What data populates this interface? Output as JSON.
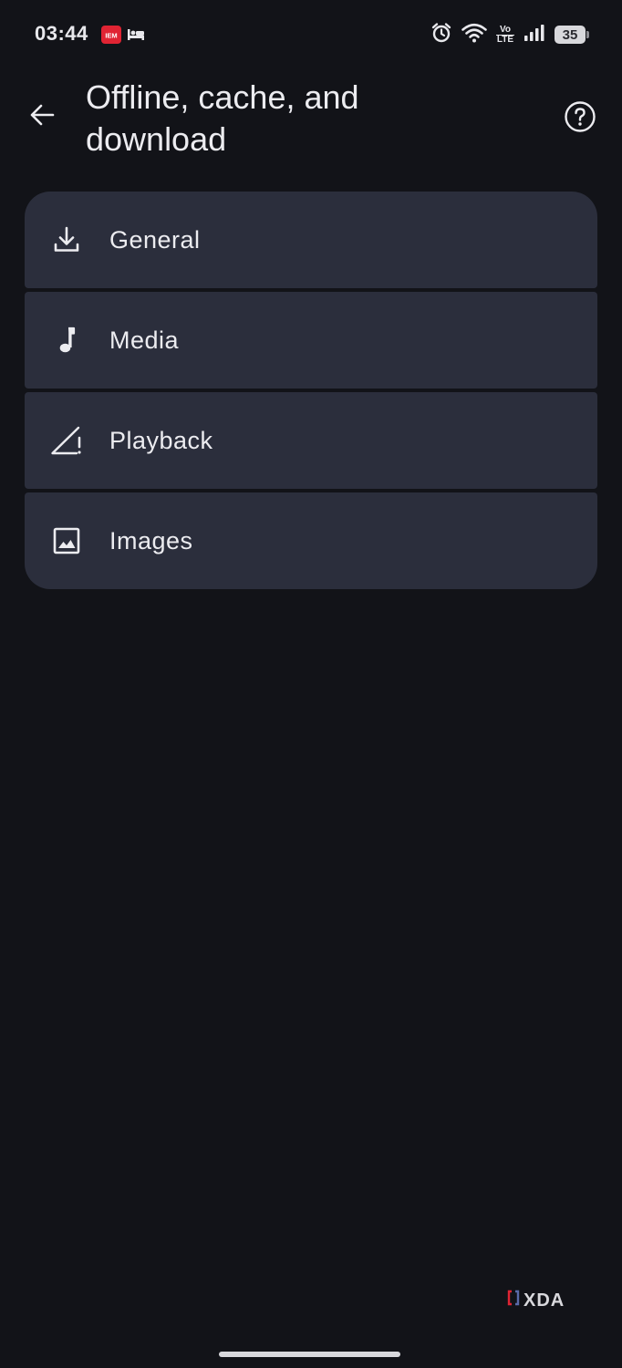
{
  "status_bar": {
    "time": "03:44",
    "notif_badge": "IEM",
    "volte_top": "Vo",
    "volte_bottom": "LTE",
    "battery": "35"
  },
  "header": {
    "title": "Offline, cache, and download"
  },
  "settings": {
    "items": [
      {
        "label": "General",
        "icon": "download-icon"
      },
      {
        "label": "Media",
        "icon": "music-note-icon"
      },
      {
        "label": "Playback",
        "icon": "signal-triangle-icon"
      },
      {
        "label": "Images",
        "icon": "image-icon"
      }
    ]
  },
  "watermark": {
    "text": "XDA"
  },
  "colors": {
    "background": "#121318",
    "card": "#2b2e3c",
    "text": "#ececf0",
    "badge_red": "#e02433"
  }
}
